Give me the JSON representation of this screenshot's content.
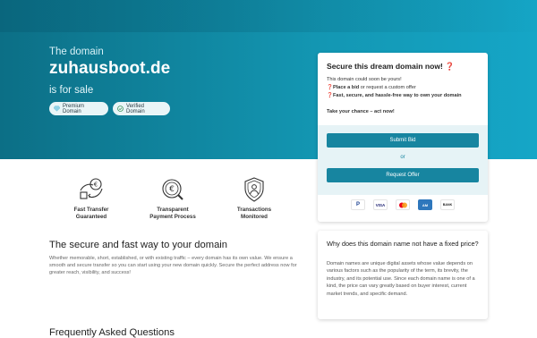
{
  "hero": {
    "the_domain": "The domain",
    "domain": "zuhausboot.de",
    "for_sale": "is for sale",
    "badges": [
      {
        "label": "Premium Domain",
        "icon": "diamond-icon"
      },
      {
        "label": "Verified Domain",
        "icon": "check-circle-icon"
      }
    ]
  },
  "card": {
    "title": "Secure this dream domain now! ❓",
    "line1": "This domain could soon be yours!",
    "line2_bold": "Place a bid",
    "line2_rest": " or request a custom offer",
    "line3_bold": "Fast, secure, and hassle-free way to own your domain",
    "line_prefix": "❓",
    "cta": "Take your chance – act now!",
    "submit_bid": "Submit Bid",
    "or": "or",
    "request_offer": "Request Offer",
    "payments": [
      "PayPal",
      "VISA",
      "Mastercard",
      "Amex",
      "Bank transfer"
    ],
    "bank_label": "BANK",
    "visa_label": "VISA",
    "paypal_label": "P",
    "amex_label": "AM"
  },
  "features": [
    {
      "line1": "Fast Transfer",
      "line2": "Guaranteed",
      "icon": "fast-transfer-icon"
    },
    {
      "line1": "Transparent",
      "line2": "Payment Process",
      "icon": "euro-search-icon"
    },
    {
      "line1": "Transactions",
      "line2": "Monitored",
      "icon": "shield-person-icon"
    }
  ],
  "secure_section": {
    "title": "The secure and fast way to your domain",
    "body": "Whether memorable, short, established, or with existing traffic – every domain has its own value. We ensure a smooth and secure transfer so you can start using your new domain quickly. Secure the perfect address now for greater reach, visibility, and success!"
  },
  "faq": {
    "title": "Frequently Asked Questions"
  },
  "price_card": {
    "title": "Why does this domain name not have a fixed price?",
    "body": "Domain names are unique digital assets whose value depends on various factors such as the popularity of the term, its brevity, the industry, and its potential use. Since each domain name is one of a kind, the price can vary greatly based on buyer interest, current market trends, and specific demand."
  },
  "colors": {
    "hero_start": "#0c6f86",
    "hero_end": "#15a6c7",
    "button": "#1785a0",
    "action_bg": "#e6f3f6"
  }
}
